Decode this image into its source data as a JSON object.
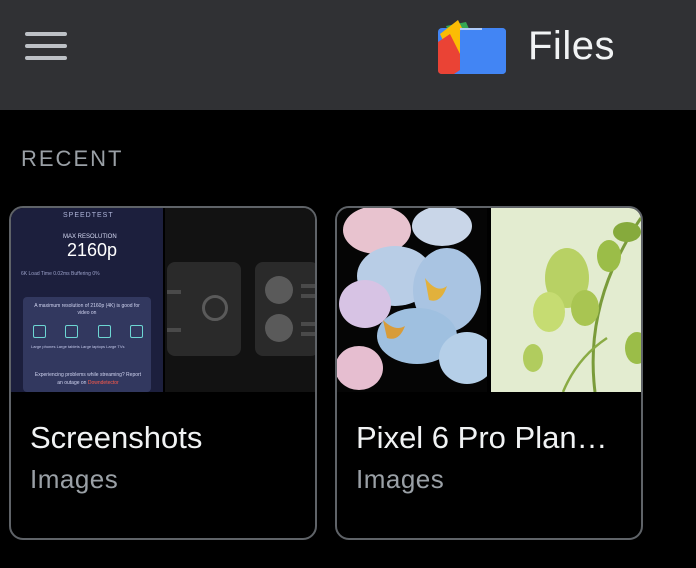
{
  "app_bar": {
    "title": "Files",
    "menu_icon": "hamburger-menu-icon",
    "logo_icon": "files-app-logo-icon",
    "background": "#303134"
  },
  "recent": {
    "heading": "RECENT",
    "items": [
      {
        "title": "Screenshots",
        "subtitle": "Images",
        "thumbnail": {
          "header": "SPEEDTEST",
          "res_label": "MAX RESOLUTION",
          "res_value": "2160p",
          "stats": "6K Load Time  0.02ms        Buffering  0%",
          "box_text": "A maximum resolution of 2160p (4K) is good for video on",
          "device_labels": "Large phones   Large tablets   Large laptops   Large TVs",
          "footer_text": "Experiencing problems while streaming? Report an outage on",
          "footer_brand": "Downdetector"
        }
      },
      {
        "title": "Pixel 6 Pro Plan…",
        "subtitle": "Images"
      }
    ]
  },
  "colors": {
    "background": "#000000",
    "card_border": "#5f6368",
    "primary_text": "#f1f3f4",
    "secondary_text": "#9aa0a6"
  }
}
